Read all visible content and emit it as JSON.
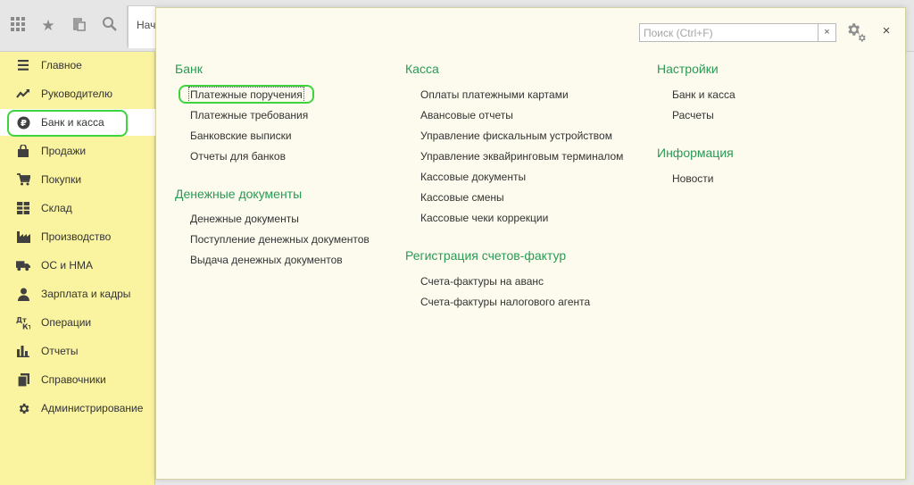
{
  "toolbar": {
    "icons": [
      "apps-grid-icon",
      "favorites-star-icon",
      "history-icon",
      "search-icon"
    ],
    "start_tab_label": "Нач"
  },
  "sidebar": {
    "items": [
      {
        "label": "Главное",
        "icon": "menu-lines-icon"
      },
      {
        "label": "Руководителю",
        "icon": "trend-chart-icon"
      },
      {
        "label": "Банк и касса",
        "icon": "ruble-coin-icon",
        "active": true
      },
      {
        "label": "Продажи",
        "icon": "shopping-bag-icon"
      },
      {
        "label": "Покупки",
        "icon": "cart-icon"
      },
      {
        "label": "Склад",
        "icon": "warehouse-grid-icon"
      },
      {
        "label": "Производство",
        "icon": "factory-icon"
      },
      {
        "label": "ОС и НМА",
        "icon": "truck-icon"
      },
      {
        "label": "Зарплата и кадры",
        "icon": "person-icon"
      },
      {
        "label": "Операции",
        "icon": "operations-icon"
      },
      {
        "label": "Отчеты",
        "icon": "bar-chart-icon"
      },
      {
        "label": "Справочники",
        "icon": "directory-books-icon"
      },
      {
        "label": "Администрирование",
        "icon": "gear-icon"
      }
    ],
    "highlight_color": "#3ed43e"
  },
  "panel": {
    "search_placeholder": "Поиск (Ctrl+F)",
    "search_value": "",
    "clear_symbol": "×",
    "close_symbol": "×",
    "groups": {
      "bank": {
        "title": "Банк",
        "links": [
          "Платежные поручения",
          "Платежные требования",
          "Банковские выписки",
          "Отчеты для банков"
        ]
      },
      "money_docs": {
        "title": "Денежные документы",
        "links": [
          "Денежные документы",
          "Поступление денежных документов",
          "Выдача денежных документов"
        ]
      },
      "kassa": {
        "title": "Касса",
        "links": [
          "Оплаты платежными картами",
          "Авансовые отчеты",
          "Управление фискальным устройством",
          "Управление эквайринговым терминалом",
          "Кассовые документы",
          "Кассовые смены",
          "Кассовые чеки коррекции"
        ]
      },
      "invoices": {
        "title": "Регистрация счетов-фактур",
        "links": [
          "Счета-фактуры на аванс",
          "Счета-фактуры налогового агента"
        ]
      },
      "settings": {
        "title": "Настройки",
        "links": [
          "Банк и касса",
          "Расчеты"
        ]
      },
      "info": {
        "title": "Информация",
        "links": [
          "Новости"
        ]
      }
    }
  },
  "colors": {
    "sidebar_bg": "#faf3a0",
    "panel_bg": "#fcfbee",
    "group_title": "#2a9a55",
    "highlight": "#3ed43e"
  }
}
